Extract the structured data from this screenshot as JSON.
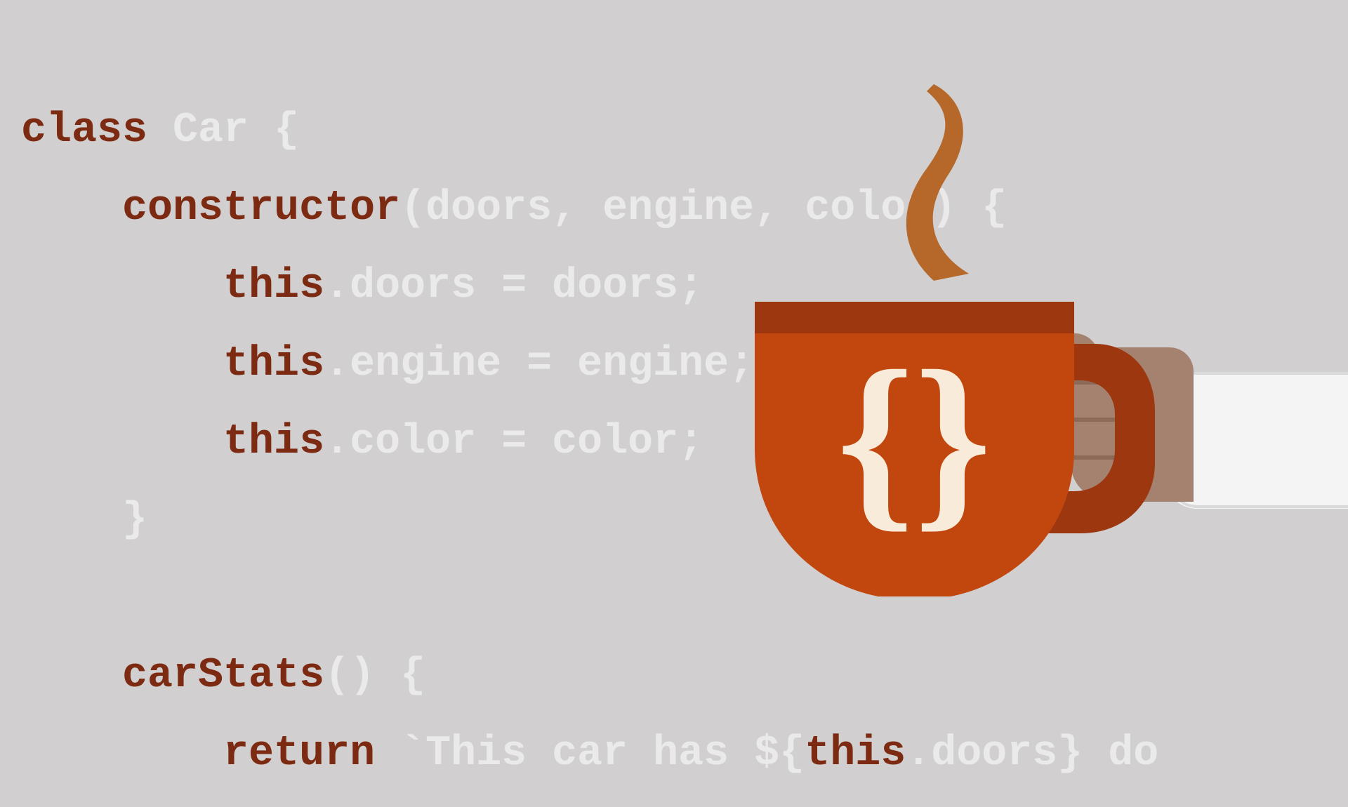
{
  "code": {
    "line1": {
      "t1": "class ",
      "t2": "Car {"
    },
    "line2": {
      "indent": "    ",
      "t1": "constructor",
      "t2": "(doors, engine, color) {"
    },
    "line3": {
      "indent": "        ",
      "t1": "this",
      "t2": ".doors = doors;"
    },
    "line4": {
      "indent": "        ",
      "t1": "this",
      "t2": ".engine = engine;"
    },
    "line5": {
      "indent": "        ",
      "t1": "this",
      "t2": ".color = color;"
    },
    "line6": {
      "indent": "    ",
      "t1": "}"
    },
    "line7": {
      "indent": " "
    },
    "line8": {
      "indent": "    ",
      "t1": "carStats",
      "t2": "() {"
    },
    "line9": {
      "indent": "        ",
      "t1": "return ",
      "t2": "`This car has ${",
      "t3": "this",
      "t4": ".doors} do"
    }
  },
  "mug": {
    "symbol": "{}"
  }
}
